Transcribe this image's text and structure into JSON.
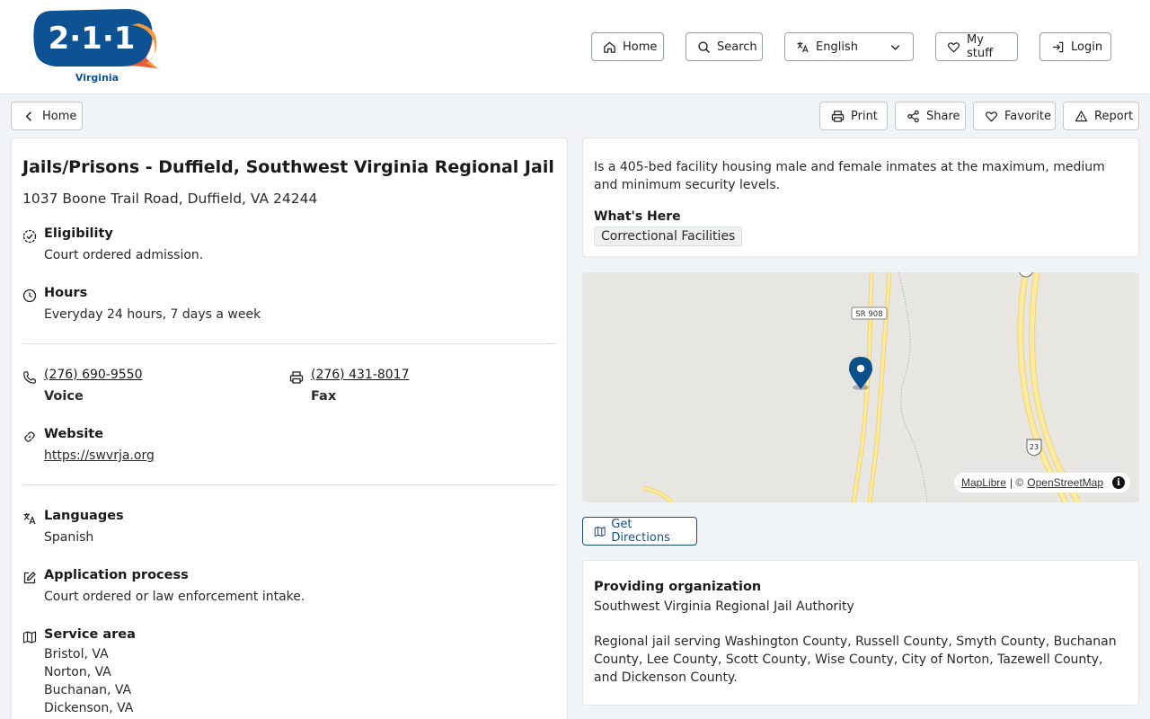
{
  "header": {
    "logo_number": "2·1·1",
    "logo_caption": "Virginia",
    "nav": {
      "home": "Home",
      "search": "Search",
      "language": "English",
      "my_stuff": "My stuff",
      "login": "Login"
    }
  },
  "toolbar": {
    "back": "Home",
    "print": "Print",
    "share": "Share",
    "favorite": "Favorite",
    "report": "Report"
  },
  "listing": {
    "title": "Jails/Prisons - Duffield, Southwest Virginia Regional Jail",
    "address": "1037 Boone Trail Road, Duffield, VA 24244",
    "eligibility_label": "Eligibility",
    "eligibility": "Court ordered admission.",
    "hours_label": "Hours",
    "hours": "Everyday 24 hours, 7 days a week",
    "phone": "(276) 690-9550",
    "phone_label": "Voice",
    "fax": "(276) 431-8017",
    "fax_label": "Fax",
    "website_label": "Website",
    "website": "https://swvrja.org",
    "languages_label": "Languages",
    "languages": "Spanish",
    "application_label": "Application process",
    "application": "Court ordered or law enforcement intake.",
    "service_area_label": "Service area",
    "service_area": [
      "Bristol, VA",
      "Norton, VA",
      "Buchanan, VA",
      "Dickenson, VA"
    ]
  },
  "details": {
    "description": "Is a 405-bed facility housing male and female inmates at the maximum, medium and minimum security levels.",
    "whats_here_label": "What's Here",
    "tag": "Correctional Facilities"
  },
  "map": {
    "road_label_1": "SR 908",
    "road_label_2": "23",
    "attribution_1": "MapLibre",
    "attribution_sep": "| ©",
    "attribution_2": "OpenStreetMap",
    "info_glyph": "i"
  },
  "directions": {
    "label": "Get Directions"
  },
  "organization": {
    "label": "Providing organization",
    "name": "Southwest Virginia Regional Jail Authority",
    "description": "Regional jail serving Washington County, Russell County, Smyth County, Buchanan County, Lee County, Scott County, Wise County, City of Norton, Tazewell County, and Dickenson County."
  },
  "colors": {
    "brand_blue": "#0d5293",
    "accent_orange": "#f39a3c",
    "pin_blue": "#0b4f8a",
    "road_yellow": "#f7e48a"
  }
}
